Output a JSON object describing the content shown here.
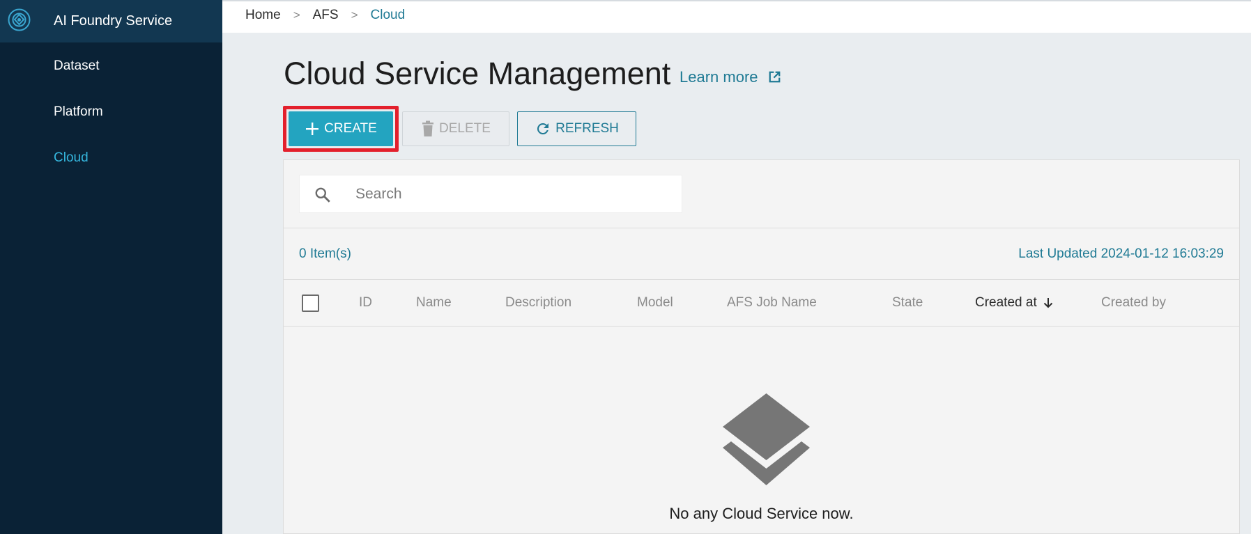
{
  "sidebar": {
    "app_title": "AI Foundry Service",
    "items": [
      {
        "label": "Dataset"
      },
      {
        "label": "Platform"
      },
      {
        "label": "Cloud"
      }
    ],
    "active_item": "Cloud"
  },
  "breadcrumb": {
    "items": [
      "Home",
      "AFS",
      "Cloud"
    ],
    "separator": ">"
  },
  "page": {
    "title": "Cloud Service Management",
    "learn_more": "Learn more"
  },
  "toolbar": {
    "create_label": "CREATE",
    "delete_label": "DELETE",
    "refresh_label": "REFRESH"
  },
  "search": {
    "placeholder": "Search",
    "value": ""
  },
  "list": {
    "items_count": "0 Item(s)",
    "last_updated": "Last Updated 2024-01-12 16:03:29",
    "columns": [
      "ID",
      "Name",
      "Description",
      "Model",
      "AFS Job Name",
      "State",
      "Created at",
      "Created by"
    ],
    "sorted_column": "Created at",
    "sort_direction": "descending",
    "empty_message": "No any Cloud Service now."
  },
  "colors": {
    "sidebar_bg": "#0a2236",
    "accent": "#23a4c0",
    "link": "#1f7a94",
    "highlight_outline": "#e3202c"
  },
  "icons": {
    "logo": "afs-logo-icon",
    "learn_more": "external-link-icon",
    "create": "plus-icon",
    "delete": "trash-icon",
    "refresh": "refresh-icon",
    "search": "search-icon",
    "sort": "arrow-down-icon",
    "empty": "layers-icon"
  }
}
